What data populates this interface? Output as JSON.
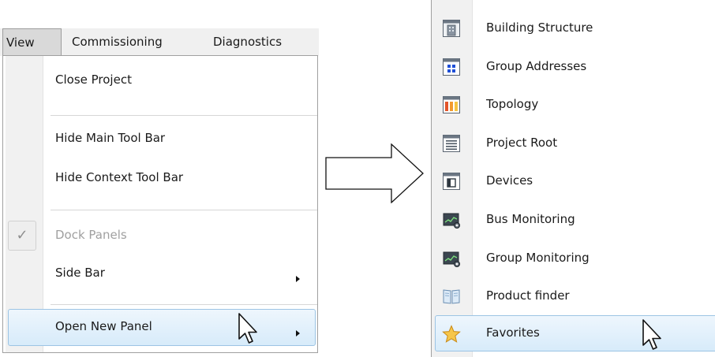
{
  "menubar": {
    "view": "View",
    "commissioning": "Commissioning",
    "diagnostics": "Diagnostics"
  },
  "view_menu": {
    "items": [
      {
        "label": "Close Project"
      },
      {
        "label": "Hide Main Tool Bar"
      },
      {
        "label": "Hide Context Tool Bar"
      },
      {
        "label": "Dock Panels",
        "checked": true,
        "disabled": true
      },
      {
        "label": "Side Bar",
        "has_submenu": true
      },
      {
        "label": "Open New Panel",
        "has_submenu": true,
        "highlighted": true
      }
    ],
    "check_glyph": "✓"
  },
  "panel_submenu": {
    "items": [
      {
        "label": "Building Structure",
        "icon": "building-icon"
      },
      {
        "label": "Group Addresses",
        "icon": "group-addresses-icon"
      },
      {
        "label": "Topology",
        "icon": "topology-icon"
      },
      {
        "label": "Project Root",
        "icon": "project-root-icon"
      },
      {
        "label": "Devices",
        "icon": "devices-icon"
      },
      {
        "label": "Bus Monitoring",
        "icon": "monitor-icon"
      },
      {
        "label": "Group Monitoring",
        "icon": "monitor-icon"
      },
      {
        "label": "Product finder",
        "icon": "book-icon"
      },
      {
        "label": "Favorites",
        "icon": "star-icon",
        "highlighted": true
      }
    ]
  },
  "colors": {
    "highlight_border": "#9cc4e4",
    "highlight_fill": "#d7ebfa",
    "gutter": "#f1f1f1"
  }
}
